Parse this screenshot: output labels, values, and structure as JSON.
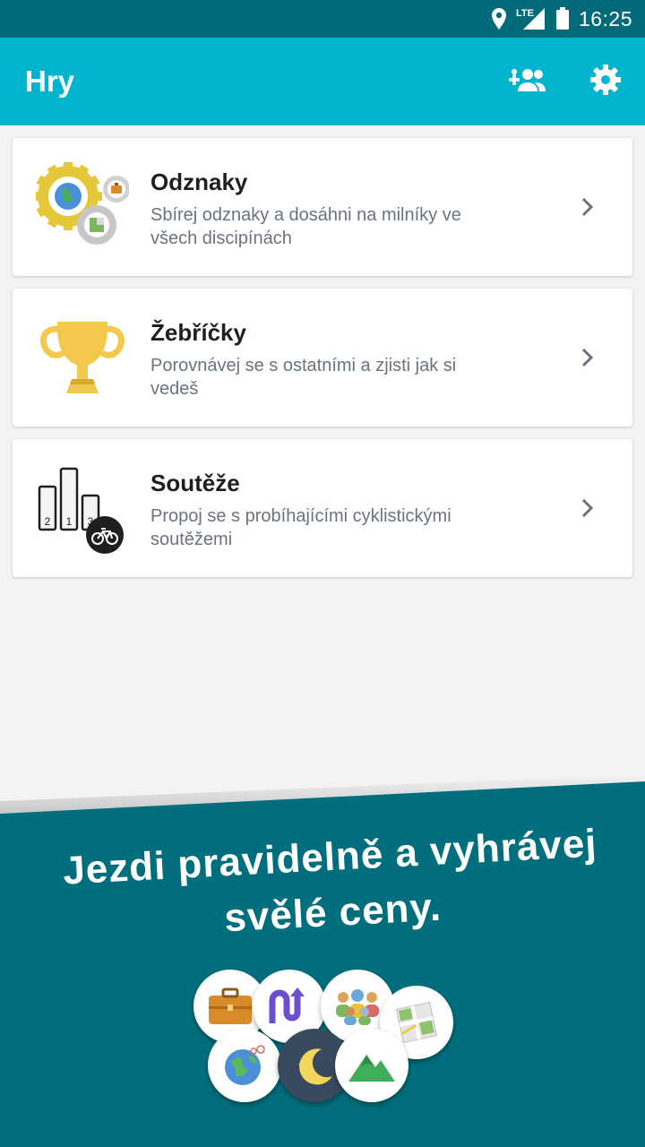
{
  "status_bar": {
    "time": "16:25",
    "network": "LTE",
    "icons": [
      "location-icon",
      "signal-icon",
      "battery-icon"
    ]
  },
  "app_bar": {
    "title": "Hry",
    "actions": [
      {
        "name": "add-friend",
        "icon": "add-person-icon"
      },
      {
        "name": "settings",
        "icon": "gear-icon"
      }
    ]
  },
  "menu": {
    "items": [
      {
        "title": "Odznaky",
        "subtitle": "Sbírej odznaky a dosáhni na milníky ve všech discipínách",
        "icon": "badges-gears-icon"
      },
      {
        "title": "Žebříčky",
        "subtitle": "Porovnávej se s ostatními a zjisti jak si vedeš",
        "icon": "trophy-icon"
      },
      {
        "title": "Soutěže",
        "subtitle": "Propoj se s probíhajícími cyklistickými soutěžemi",
        "icon": "podium-icon",
        "podium_labels": [
          "2",
          "1",
          "3"
        ]
      }
    ]
  },
  "promo": {
    "text": "Jezdi pravidelně a vyhrávej svělé ceny.",
    "badges": [
      "briefcase-badge-icon",
      "up-arrows-badge-icon",
      "group-badge-icon",
      "map-badge-icon",
      "globe-badge-icon",
      "moon-badge-icon",
      "mountain-badge-icon"
    ]
  },
  "colors": {
    "status_bar": "#006a79",
    "app_bar": "#00b4ce",
    "promo_band": "#006e7c",
    "background": "#f2f3f5"
  }
}
